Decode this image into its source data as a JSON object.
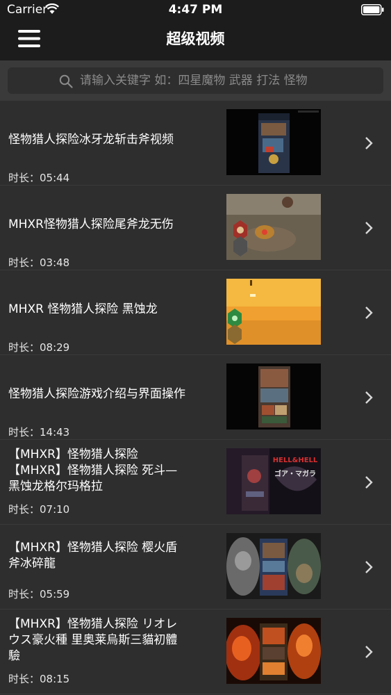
{
  "status_bar": {
    "carrier": "Carrier",
    "time": "4:47 PM"
  },
  "nav": {
    "title": "超级视频",
    "menu_icon": "hamburger-menu-icon"
  },
  "search": {
    "placeholder": "请输入关键字 如：四星魔物 武器 打法 怪物",
    "icon": "search-icon"
  },
  "videos": [
    {
      "title": "怪物猎人探险冰牙龙斩击斧视频",
      "duration": "时长：05:44"
    },
    {
      "title": "MHXR怪物猎人探险尾斧龙无伤",
      "duration": "时长：03:48"
    },
    {
      "title": "MHXR 怪物猎人探险 黑蚀龙",
      "duration": "时长：08:29"
    },
    {
      "title": "怪物猎人探险游戏介绍与界面操作",
      "duration": "时长：14:43"
    },
    {
      "title": "【MHXR】怪物猎人探险\n【MHXR】怪物猎人探险 死斗—\n黑蚀龙格尔玛格拉",
      "duration": "时长：07:10"
    },
    {
      "title": "【MHXR】怪物猎人探险 樱火盾\n斧冰碎龍",
      "duration": "时长：05:59"
    },
    {
      "title": "【MHXR】怪物猎人探险 リオレ\nウス豪火種 里奥莱烏斯三貓初體\n驗",
      "duration": "时长：08:15"
    }
  ],
  "thumbnail_text": {
    "hell_hell": "HELL&HELL",
    "gore_magala": "ゴア・マガラ"
  },
  "colors": {
    "background": "#2e2e2e",
    "header": "#1c1c1c",
    "search_section": "#3a3a3a",
    "placeholder": "#8a8a8a"
  }
}
